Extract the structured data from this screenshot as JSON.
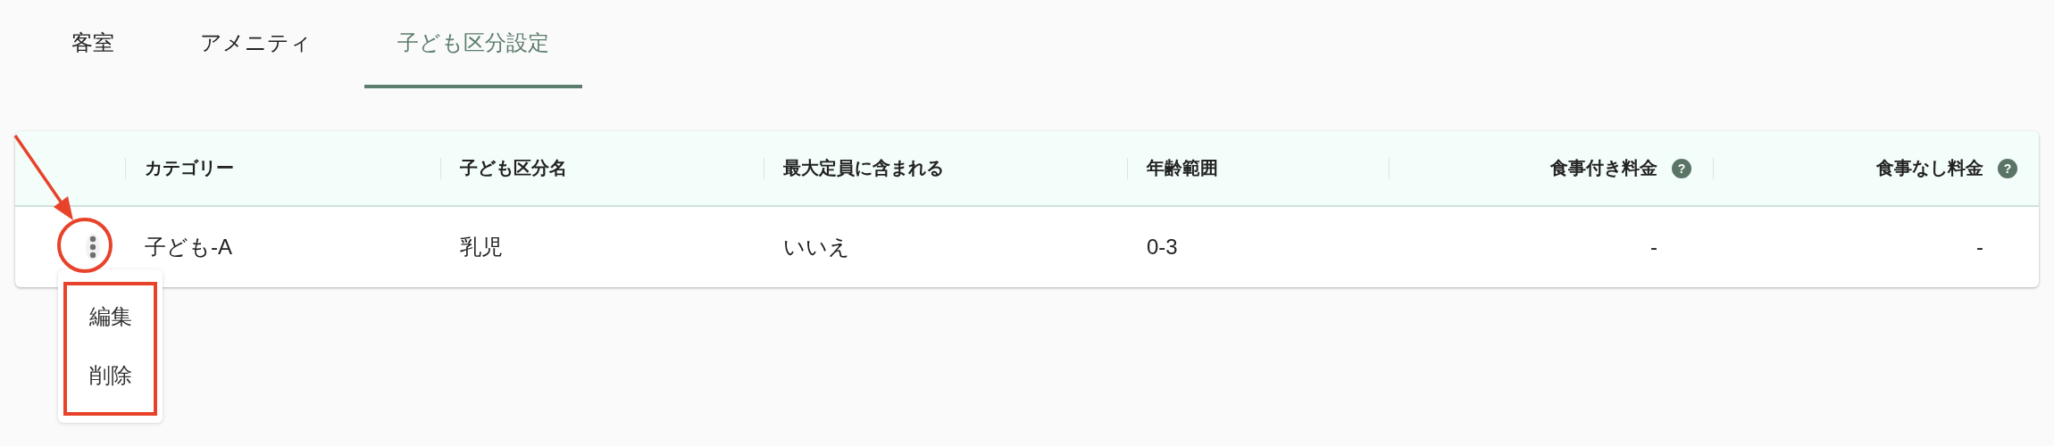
{
  "tabs": [
    {
      "label": "客室",
      "selected": false
    },
    {
      "label": "アメニティ",
      "selected": false
    },
    {
      "label": "子ども区分設定",
      "selected": true
    }
  ],
  "table": {
    "columns": [
      {
        "label": "カテゴリー",
        "kind": "text"
      },
      {
        "label": "子ども区分名",
        "kind": "text"
      },
      {
        "label": "最大定員に含まれる",
        "kind": "text"
      },
      {
        "label": "年齢範囲",
        "kind": "text"
      },
      {
        "label": "食事付き料金",
        "kind": "price",
        "hint": "?"
      },
      {
        "label": "食事なし料金",
        "kind": "price",
        "hint": "?"
      }
    ],
    "rows": [
      {
        "cells": [
          "子ども-A",
          "乳児",
          "いいえ",
          "0-3",
          "-",
          "-"
        ],
        "menu_open": true
      }
    ]
  },
  "row_menu": {
    "items": [
      "編集",
      "削除"
    ]
  },
  "annotations": [
    {
      "kind": "arrow"
    },
    {
      "kind": "circle"
    },
    {
      "kind": "frame"
    }
  ]
}
